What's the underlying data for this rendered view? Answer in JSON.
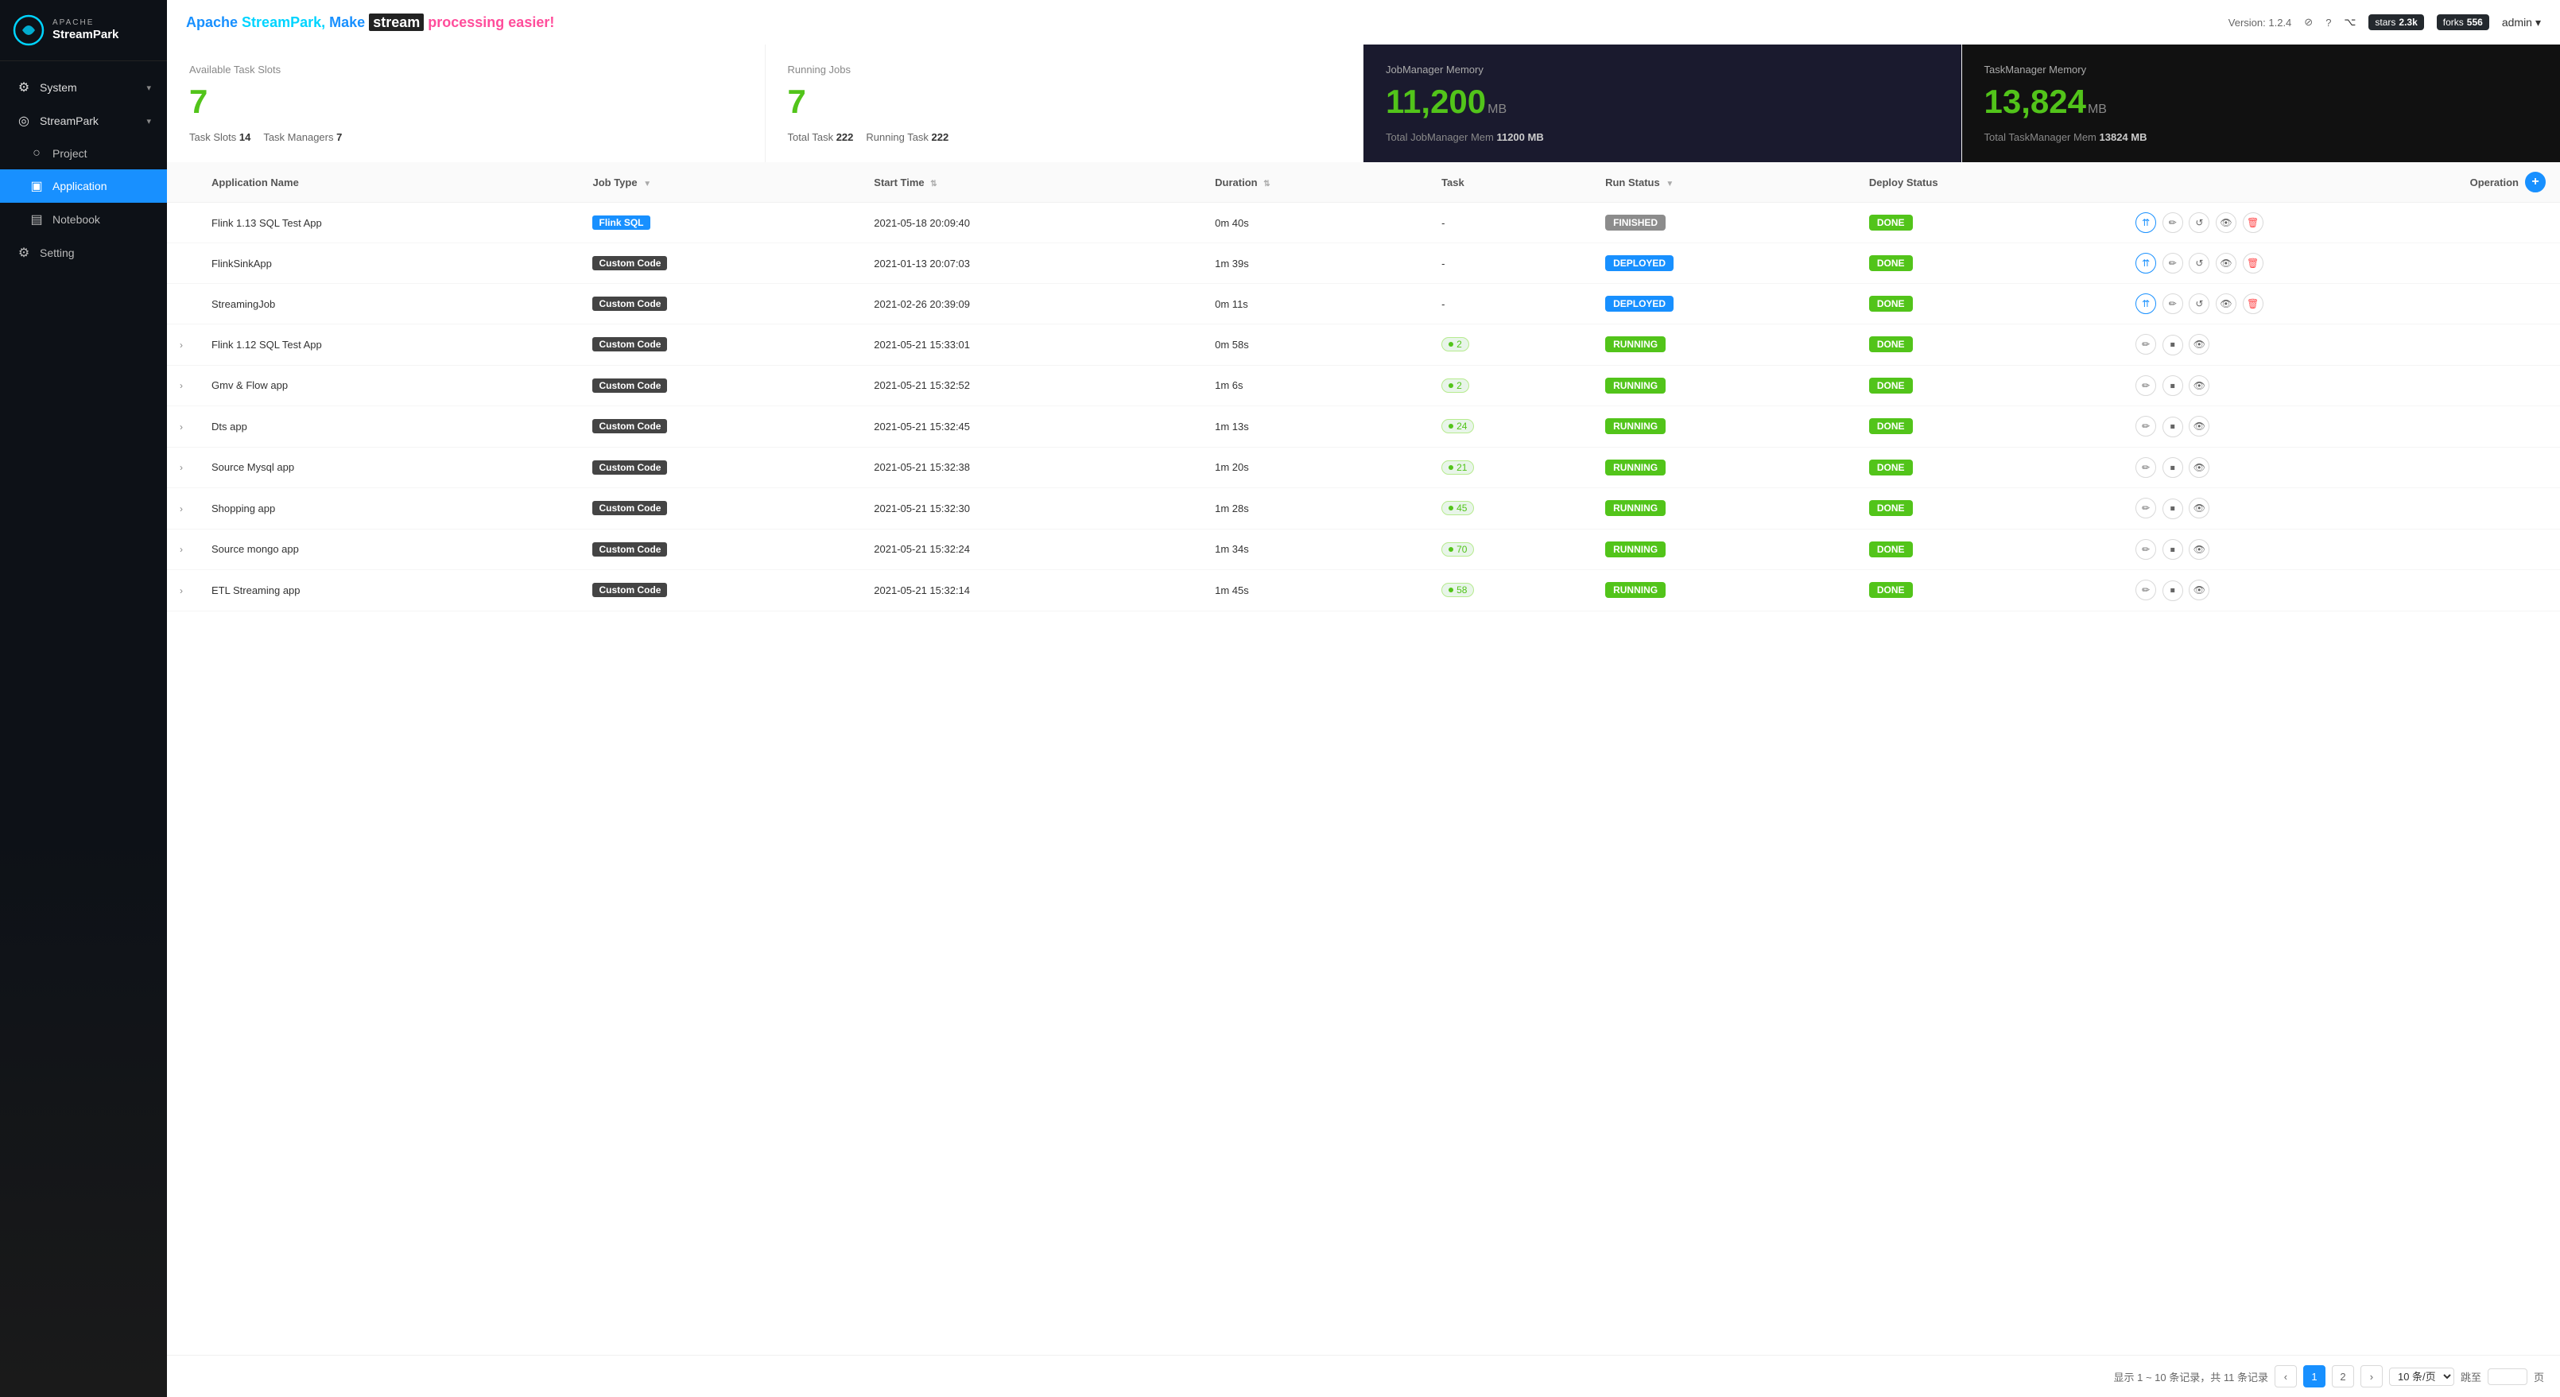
{
  "sidebar": {
    "logo": {
      "apache": "APACHE",
      "streampark": "StreamPark"
    },
    "items": [
      {
        "id": "system",
        "label": "System",
        "icon": "⚙",
        "has_arrow": true,
        "active": false
      },
      {
        "id": "streampark",
        "label": "StreamPark",
        "icon": "◎",
        "has_arrow": true,
        "active": false,
        "expanded": true
      },
      {
        "id": "project",
        "label": "Project",
        "icon": "○",
        "active": false,
        "indent": true
      },
      {
        "id": "application",
        "label": "Application",
        "icon": "▣",
        "active": true,
        "indent": true
      },
      {
        "id": "notebook",
        "label": "Notebook",
        "icon": "▤",
        "active": false,
        "indent": true
      },
      {
        "id": "setting",
        "label": "Setting",
        "icon": "⚙",
        "active": false
      }
    ]
  },
  "header": {
    "title_parts": [
      {
        "text": "Apache",
        "class": "apache"
      },
      {
        "text": " StreamPark,",
        "class": "streampark"
      },
      {
        "text": " Make ",
        "class": "make"
      },
      {
        "text": " stream ",
        "class": "stream_bg"
      },
      {
        "text": " processing ",
        "class": "processing"
      },
      {
        "text": " easier!",
        "class": "easier"
      }
    ],
    "title_full": "Apache StreamPark, Make  stream  processing  easier!",
    "version": "Version: 1.2.4",
    "stars_label": "stars",
    "stars_count": "2.3k",
    "forks_label": "forks",
    "forks_count": "556",
    "admin_label": "admin"
  },
  "stats": [
    {
      "id": "task-slots",
      "label": "Available Task Slots",
      "value": "7",
      "footer_items": [
        {
          "key": "Task Slots",
          "value": "14"
        },
        {
          "key": "Task Managers",
          "value": "7"
        }
      ]
    },
    {
      "id": "running-jobs",
      "label": "Running Jobs",
      "value": "7",
      "footer_items": [
        {
          "key": "Total Task",
          "value": "222"
        },
        {
          "key": "Running Task",
          "value": "222"
        }
      ]
    },
    {
      "id": "jobmanager-mem",
      "label": "JobManager Memory",
      "value": "11,200",
      "unit": "MB",
      "footer_items": [
        {
          "key": "Total JobManager Mem",
          "value": "11200 MB"
        }
      ]
    },
    {
      "id": "taskmanager-mem",
      "label": "TaskManager Memory",
      "value": "13,824",
      "unit": "MB",
      "footer_items": [
        {
          "key": "Total TaskManager Mem",
          "value": "13824 MB"
        }
      ]
    }
  ],
  "table": {
    "columns": [
      {
        "id": "expand",
        "label": ""
      },
      {
        "id": "app-name",
        "label": "Application Name",
        "sortable": false,
        "filterable": false
      },
      {
        "id": "job-type",
        "label": "Job Type",
        "sortable": false,
        "filterable": true
      },
      {
        "id": "start-time",
        "label": "Start Time",
        "sortable": true
      },
      {
        "id": "duration",
        "label": "Duration",
        "sortable": true
      },
      {
        "id": "task",
        "label": "Task",
        "sortable": false
      },
      {
        "id": "run-status",
        "label": "Run Status",
        "sortable": false,
        "filterable": true
      },
      {
        "id": "deploy-status",
        "label": "Deploy Status",
        "sortable": false
      },
      {
        "id": "operation",
        "label": "Operation",
        "sortable": false,
        "add_btn": true
      }
    ],
    "rows": [
      {
        "id": 1,
        "expandable": false,
        "app_name": "Flink 1.13 SQL Test App",
        "job_type": "Flink SQL",
        "job_type_class": "badge-flink-sql",
        "start_time": "2021-05-18 20:09:40",
        "duration": "0m 40s",
        "task": "-",
        "task_type": "none",
        "run_status": "FINISHED",
        "run_status_class": "status-finished",
        "deploy_status": "DONE",
        "ops": [
          "deploy",
          "edit",
          "restart",
          "view",
          "delete"
        ]
      },
      {
        "id": 2,
        "expandable": false,
        "app_name": "FlinkSinkApp",
        "job_type": "Custom Code",
        "job_type_class": "badge-custom-code",
        "start_time": "2021-01-13 20:07:03",
        "duration": "1m 39s",
        "task": "-",
        "task_type": "none",
        "run_status": "DEPLOYED",
        "run_status_class": "status-deployed",
        "deploy_status": "DONE",
        "ops": [
          "deploy",
          "edit",
          "restart",
          "view",
          "delete"
        ]
      },
      {
        "id": 3,
        "expandable": false,
        "app_name": "StreamingJob",
        "job_type": "Custom Code",
        "job_type_class": "badge-custom-code",
        "start_time": "2021-02-26 20:39:09",
        "duration": "0m 11s",
        "task": "-",
        "task_type": "none",
        "run_status": "DEPLOYED",
        "run_status_class": "status-deployed",
        "deploy_status": "DONE",
        "ops": [
          "deploy",
          "edit",
          "restart",
          "view",
          "delete"
        ]
      },
      {
        "id": 4,
        "expandable": true,
        "app_name": "Flink 1.12 SQL Test App",
        "job_type": "Custom Code",
        "job_type_class": "badge-custom-code",
        "start_time": "2021-05-21 15:33:01",
        "duration": "0m 58s",
        "task_count": "2",
        "task_type": "count",
        "run_status": "RUNNING",
        "run_status_class": "status-running",
        "deploy_status": "DONE",
        "ops": [
          "edit",
          "stop",
          "view"
        ]
      },
      {
        "id": 5,
        "expandable": true,
        "app_name": "Gmv & Flow app",
        "job_type": "Custom Code",
        "job_type_class": "badge-custom-code",
        "start_time": "2021-05-21 15:32:52",
        "duration": "1m 6s",
        "task_count": "2",
        "task_type": "count",
        "run_status": "RUNNING",
        "run_status_class": "status-running",
        "deploy_status": "DONE",
        "ops": [
          "edit",
          "stop",
          "view"
        ]
      },
      {
        "id": 6,
        "expandable": true,
        "app_name": "Dts app",
        "job_type": "Custom Code",
        "job_type_class": "badge-custom-code",
        "start_time": "2021-05-21 15:32:45",
        "duration": "1m 13s",
        "task_count": "24",
        "task_type": "count",
        "run_status": "RUNNING",
        "run_status_class": "status-running",
        "deploy_status": "DONE",
        "ops": [
          "edit",
          "stop",
          "view"
        ]
      },
      {
        "id": 7,
        "expandable": true,
        "app_name": "Source Mysql app",
        "job_type": "Custom Code",
        "job_type_class": "badge-custom-code",
        "start_time": "2021-05-21 15:32:38",
        "duration": "1m 20s",
        "task_count": "21",
        "task_type": "count",
        "run_status": "RUNNING",
        "run_status_class": "status-running",
        "deploy_status": "DONE",
        "ops": [
          "edit",
          "stop",
          "view"
        ]
      },
      {
        "id": 8,
        "expandable": true,
        "app_name": "Shopping app",
        "job_type": "Custom Code",
        "job_type_class": "badge-custom-code",
        "start_time": "2021-05-21 15:32:30",
        "duration": "1m 28s",
        "task_count": "45",
        "task_type": "count",
        "run_status": "RUNNING",
        "run_status_class": "status-running",
        "deploy_status": "DONE",
        "ops": [
          "edit",
          "stop",
          "view"
        ]
      },
      {
        "id": 9,
        "expandable": true,
        "app_name": "Source mongo app",
        "job_type": "Custom Code",
        "job_type_class": "badge-custom-code",
        "start_time": "2021-05-21 15:32:24",
        "duration": "1m 34s",
        "task_count": "70",
        "task_type": "count",
        "run_status": "RUNNING",
        "run_status_class": "status-running",
        "deploy_status": "DONE",
        "ops": [
          "edit",
          "stop",
          "view"
        ]
      },
      {
        "id": 10,
        "expandable": true,
        "app_name": "ETL Streaming app",
        "job_type": "Custom Code",
        "job_type_class": "badge-custom-code",
        "start_time": "2021-05-21 15:32:14",
        "duration": "1m 45s",
        "task_count": "58",
        "task_type": "count",
        "run_status": "RUNNING",
        "run_status_class": "status-running",
        "deploy_status": "DONE",
        "ops": [
          "edit",
          "stop",
          "view"
        ]
      }
    ]
  },
  "pagination": {
    "info": "显示 1 ~ 10 条记录，共 11 条记录",
    "current_page": 1,
    "total_pages": 2,
    "pages": [
      1,
      2
    ],
    "per_page_label": "10 条/页",
    "jump_label": "跳至",
    "page_label": "页",
    "prev_label": "‹",
    "next_label": "›"
  }
}
